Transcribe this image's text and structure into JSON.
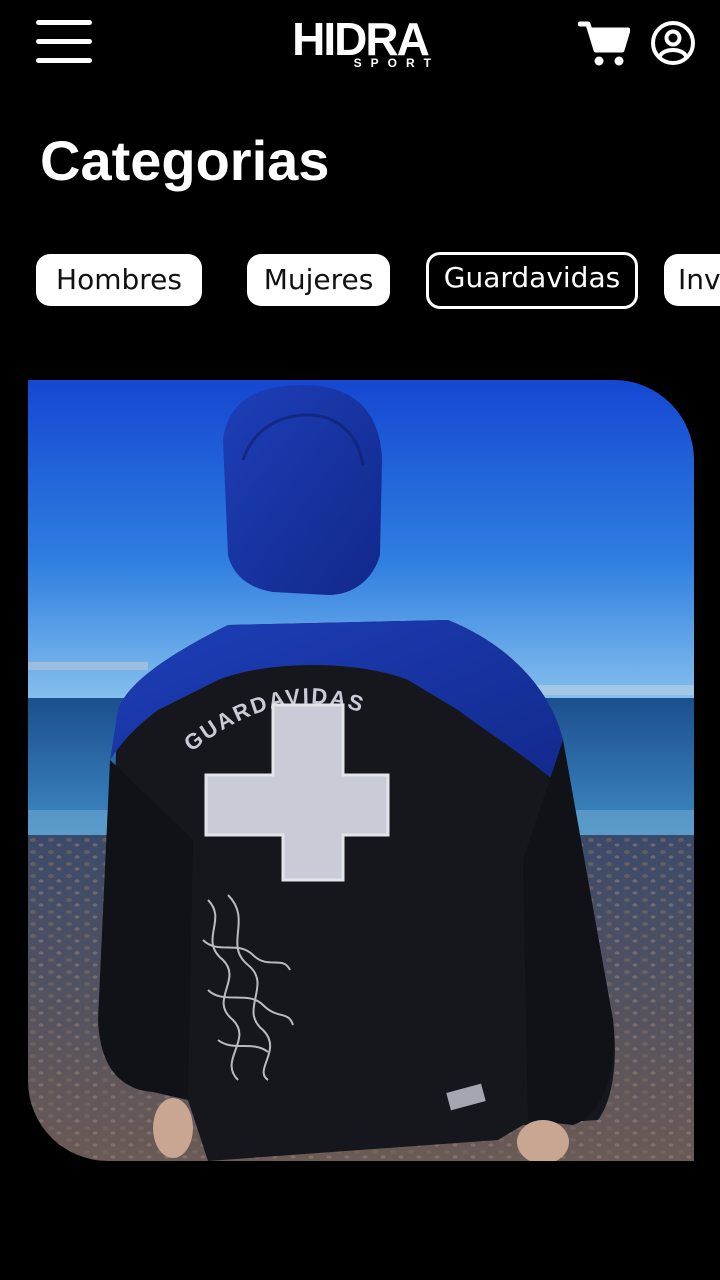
{
  "header": {
    "menu_icon": "hamburger-menu-icon",
    "logo_text": "HIDRA",
    "logo_subtext": "SPORT",
    "cart_icon": "shopping-cart-icon",
    "account_icon": "account-circle-icon"
  },
  "page": {
    "title": "Categorias"
  },
  "categories": {
    "items": [
      {
        "label": "Hombres",
        "selected": false
      },
      {
        "label": "Mujeres",
        "selected": false
      },
      {
        "label": "Guardavidas",
        "selected": true
      },
      {
        "label": "Inv",
        "selected": false
      }
    ]
  },
  "hero": {
    "print_text": "GUARDAVIDAS",
    "colors": {
      "sky_top": "#1550d8",
      "sky_bottom": "#5aa8e6",
      "sea": "#1d5fa0",
      "jacket_blue": "#1a3cb0",
      "jacket_black": "#14161c",
      "print": "#c9ccd6"
    }
  },
  "theme": {
    "background": "#000000",
    "chip_bg": "#ffffff",
    "chip_text": "#111111",
    "chip_active_border": "#ffffff"
  }
}
